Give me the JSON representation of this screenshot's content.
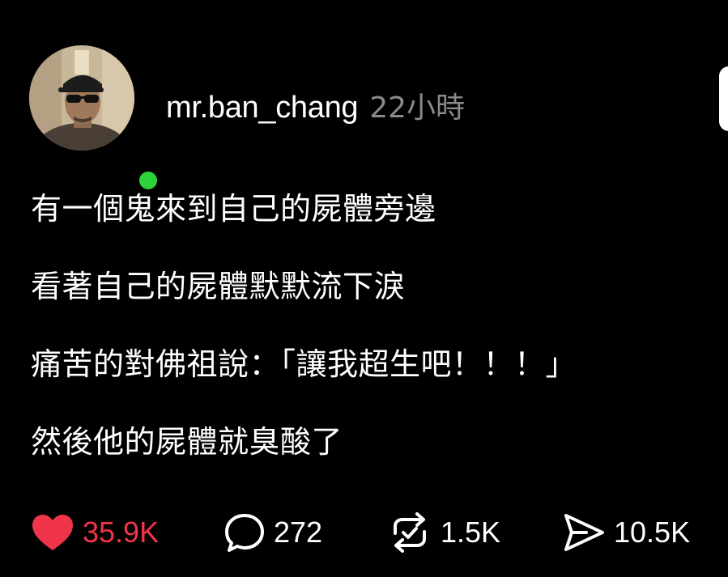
{
  "post": {
    "username": "mr.ban_chang",
    "time": "22小時",
    "lines": [
      "有一個鬼來到自己的屍體旁邊",
      "看著自己的屍體默默流下淚",
      "痛苦的對佛祖說：「讓我超生吧！！！」",
      "然後他的屍體就臭酸了"
    ]
  },
  "actions": {
    "likes": "35.9K",
    "comments": "272",
    "reposts": "1.5K",
    "shares": "10.5K"
  },
  "colors": {
    "background": "#000000",
    "text": "#ffffff",
    "muted": "#8a8a8a",
    "like": "#f0354a",
    "online": "#2ed23a"
  },
  "icons": {
    "like": "heart-icon",
    "comment": "comment-bubble-icon",
    "repost": "repost-icon",
    "share": "send-icon"
  }
}
